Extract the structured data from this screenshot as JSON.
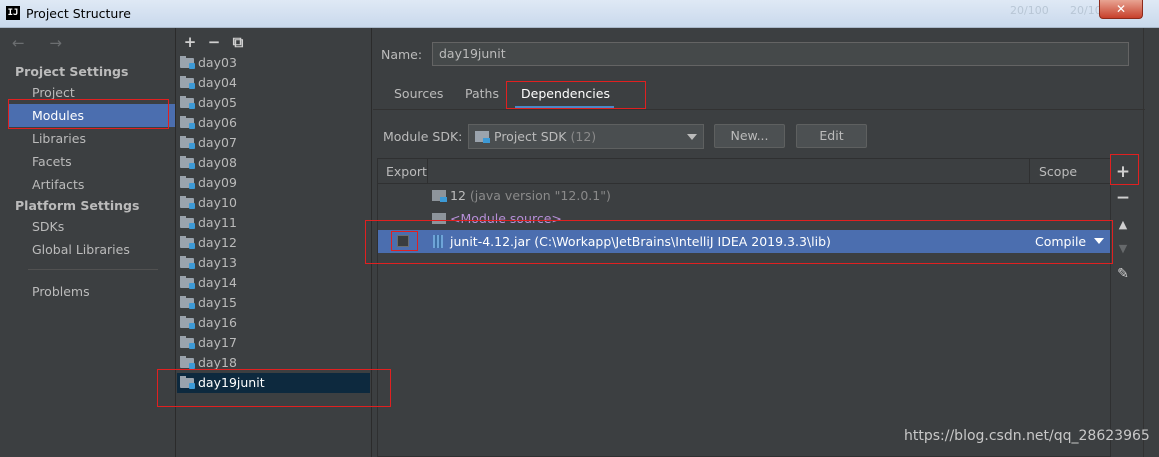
{
  "window": {
    "title": "Project Structure",
    "app_icon_text": "IJ",
    "close_label": "✕",
    "background_hints": [
      "20/100",
      "20/100"
    ]
  },
  "nav": {
    "back_forward": "← →",
    "project_settings_header": "Project Settings",
    "project_items": [
      "Project",
      "Modules",
      "Libraries",
      "Facets",
      "Artifacts"
    ],
    "platform_settings_header": "Platform Settings",
    "platform_items": [
      "SDKs",
      "Global Libraries"
    ],
    "problems": "Problems",
    "selected": "Modules"
  },
  "modules": {
    "toolbar": [
      "+",
      "−",
      "⧉"
    ],
    "list": [
      "day03",
      "day04",
      "day05",
      "day06",
      "day07",
      "day08",
      "day09",
      "day10",
      "day11",
      "day12",
      "day13",
      "day14",
      "day15",
      "day16",
      "day17",
      "day18",
      "day19junit"
    ],
    "selected": "day19junit"
  },
  "detail": {
    "name_label": "Name:",
    "name_value": "day19junit",
    "tabs": [
      "Sources",
      "Paths",
      "Dependencies"
    ],
    "active_tab": "Dependencies",
    "sdk_label": "Module SDK:",
    "sdk_value": "Project SDK",
    "sdk_version": "(12)",
    "new_button": "New...",
    "edit_button": "Edit",
    "table": {
      "col_export": "Export",
      "col_scope": "Scope",
      "rows": [
        {
          "name": "12",
          "detail": "(java version \"12.0.1\")"
        },
        {
          "name": "<Module source>",
          "detail": ""
        },
        {
          "name": "junit-4.12.jar",
          "detail": "(C:\\Workapp\\JetBrains\\IntelliJ IDEA 2019.3.3\\lib)",
          "scope": "Compile",
          "export": false
        }
      ]
    },
    "side_tools": [
      "+",
      "−",
      "▲",
      "▼",
      "✎"
    ]
  },
  "watermark": "https://blog.csdn.net/qq_28623965",
  "colors": {
    "selection": "#4b6eaf",
    "background": "#3c3f41",
    "annotation": "#e02020",
    "module_source": "#b78fd8"
  }
}
